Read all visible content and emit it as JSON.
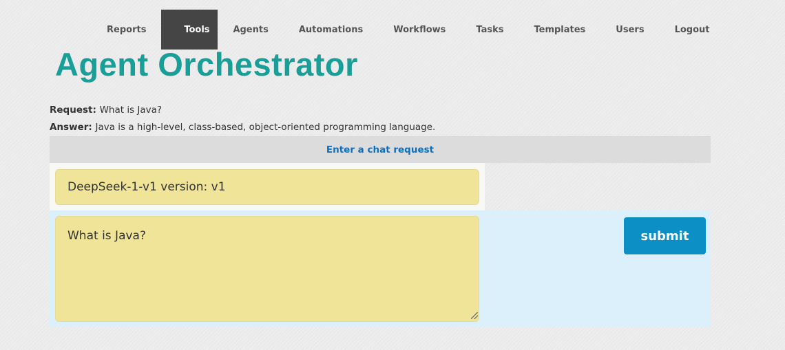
{
  "nav": {
    "items": [
      {
        "label": "Reports"
      },
      {
        "label": "Tools",
        "active": true
      },
      {
        "label": "Agents"
      },
      {
        "label": "Automations"
      },
      {
        "label": "Workflows"
      },
      {
        "label": "Tasks"
      },
      {
        "label": "Templates"
      },
      {
        "label": "Users"
      },
      {
        "label": "Logout"
      }
    ]
  },
  "page": {
    "title": "Agent Orchestrator"
  },
  "conversation": {
    "request_label": "Request:",
    "request_value": "What is Java?",
    "answer_label": "Answer:",
    "answer_value": "Java is a high-level, class-based, object-oriented programming language."
  },
  "chat": {
    "header": "Enter a chat request",
    "model_value": "DeepSeek-1-v1 version: v1",
    "input_value": "What is Java?",
    "submit_label": "submit"
  },
  "colors": {
    "title": "#1a9e98",
    "active_nav_bg": "#454545",
    "header_link": "#0b6fc2",
    "field_bg": "#f0e498",
    "input_panel_bg": "#dcf0fb",
    "submit_bg": "#0b8fc4"
  }
}
